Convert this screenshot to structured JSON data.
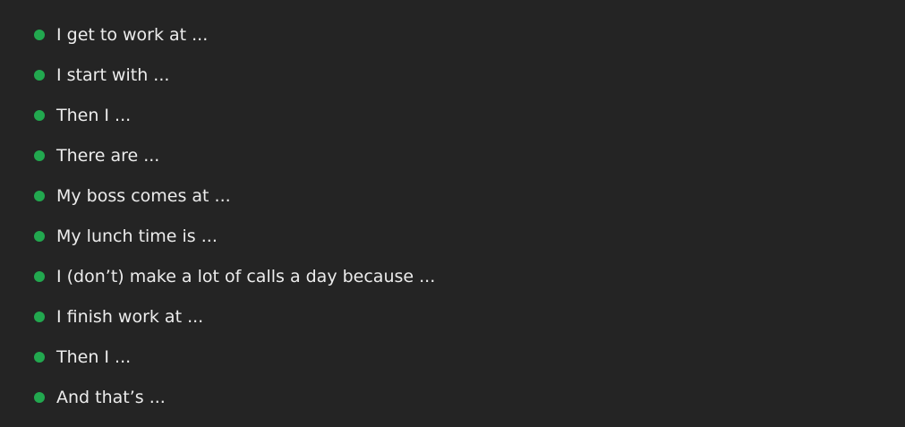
{
  "colors": {
    "background": "#242424",
    "bullet": "#22a84f",
    "text": "#ececec"
  },
  "list": {
    "bullet_icon": "filled-circle",
    "items": [
      {
        "label": "I get to work at ..."
      },
      {
        "label": "I start with ..."
      },
      {
        "label": "Then I ..."
      },
      {
        "label": "There are ..."
      },
      {
        "label": "My boss comes at ..."
      },
      {
        "label": "My lunch time is ..."
      },
      {
        "label": "I (don’t) make a lot of calls a day because ..."
      },
      {
        "label": "I finish work at ..."
      },
      {
        "label": "Then I ..."
      },
      {
        "label": "And that’s ..."
      }
    ]
  }
}
